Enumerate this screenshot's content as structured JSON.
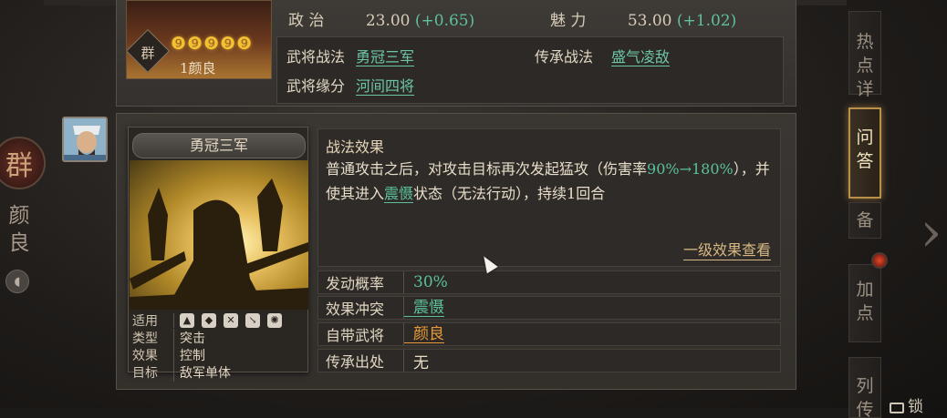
{
  "left": {
    "faction_char": "群",
    "hero_name_vertical": [
      "颜",
      "良"
    ]
  },
  "top_card": {
    "stats": [
      {
        "label": "政 治",
        "value": "23.00",
        "delta": "(+0.65)"
      },
      {
        "label": "魅 力",
        "value": "53.00",
        "delta": "(+1.02)"
      }
    ],
    "portrait": {
      "seal": "群",
      "stars": "❾❾❾❾❾",
      "name": "1颜良"
    },
    "skills": {
      "hero_skill_label": "武将战法",
      "hero_skill_value": "勇冠三军",
      "inherit_skill_label": "传承战法",
      "inherit_skill_value": "盛气凌敌",
      "bond_label": "武将缘分",
      "bond_value": "河间四将"
    }
  },
  "right_tabs": [
    "热 点 详",
    "问 答",
    "备",
    "加 点",
    "列 传"
  ],
  "lock_label": "锁",
  "skill_card": {
    "name": "勇冠三军",
    "meta": {
      "applies_label": "适用",
      "type_label": "类型",
      "type_value": "突击",
      "effect_label": "效果",
      "effect_value": "控制",
      "target_label": "目标",
      "target_value": "敌军单体"
    },
    "effect": {
      "title": "战法效果",
      "text_part1": "普通攻击之后，对攻击目标再次发起猛攻（伤害率",
      "rate": "90%→180%",
      "text_part2": "），并使其进入",
      "status": "震慑",
      "text_part3": "状态（无法行动），持续1回合",
      "level_link": "一级效果查看"
    },
    "attributes": [
      {
        "label": "发动概率",
        "value": "30%"
      },
      {
        "label": "效果冲突",
        "value": "震慑"
      },
      {
        "label": "自带武将",
        "value": "颜良"
      },
      {
        "label": "传承出处",
        "value": "无"
      }
    ]
  },
  "colors": {
    "accent_green": "#5cc09c",
    "accent_orange": "#e89a3a",
    "gold": "#d8b882"
  }
}
